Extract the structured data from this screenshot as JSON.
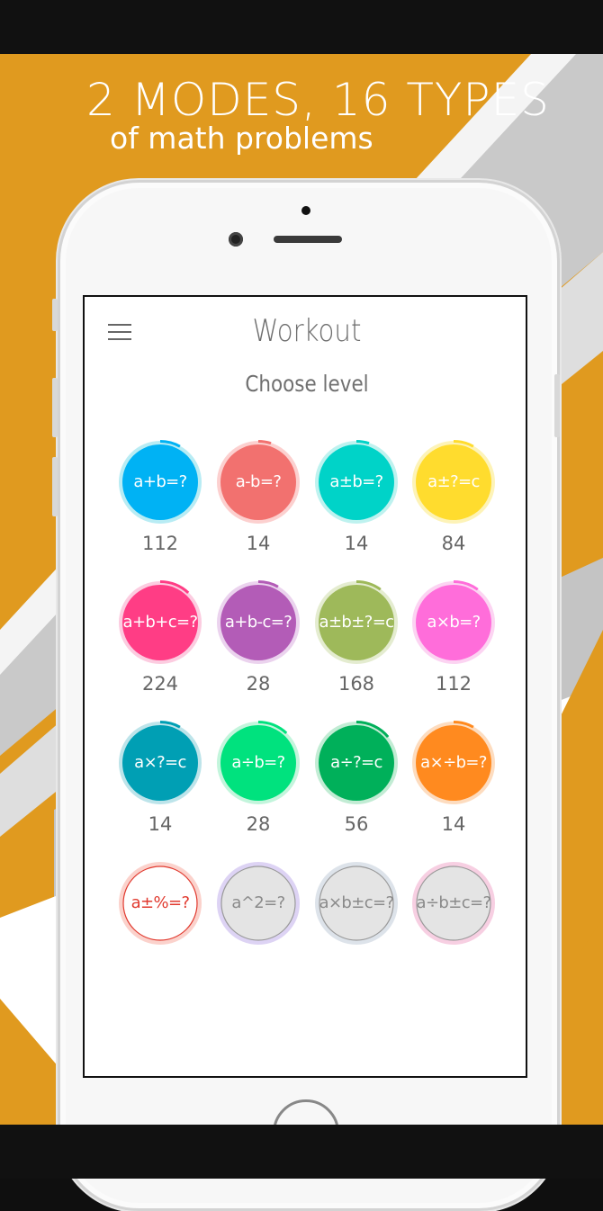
{
  "banner": {
    "line1": "2 MODES, 16 TYPES",
    "line2": "of math problems"
  },
  "colors": {
    "background_orange": "#e09a1f",
    "stripe_grey": "#c7c7c7",
    "stripe_white": "#ffffff"
  },
  "screen": {
    "title": "Workout",
    "subtitle": "Choose level",
    "menu_icon": "hamburger-menu-icon"
  },
  "levels": [
    {
      "label": "a+b=?",
      "count": "112",
      "color": "#00b2f4",
      "ring": "#b8ecf4",
      "text_color": "#ffffff",
      "progress": 0.08
    },
    {
      "label": "a-b=?",
      "count": "14",
      "color": "#f2716f",
      "ring": "#fcd0cf",
      "text_color": "#ffffff",
      "progress": 0.05
    },
    {
      "label": "a±b=?",
      "count": "14",
      "color": "#00d3c8",
      "ring": "#bef2ef",
      "text_color": "#ffffff",
      "progress": 0.05
    },
    {
      "label": "a±?=c",
      "count": "84",
      "color": "#ffdc2e",
      "ring": "#fdf3b8",
      "text_color": "#ffffff",
      "progress": 0.08
    },
    {
      "label": "a+b+c=?",
      "count": "224",
      "color": "#ff3d85",
      "ring": "#fccce0",
      "text_color": "#ffffff",
      "progress": 0.12
    },
    {
      "label": "a+b-c=?",
      "count": "28",
      "color": "#b35cb7",
      "ring": "#ebd3ee",
      "text_color": "#ffffff",
      "progress": 0.08
    },
    {
      "label": "a±b±?=c",
      "count": "168",
      "color": "#9eb95a",
      "ring": "#e4ecd0",
      "text_color": "#ffffff",
      "progress": 0.1
    },
    {
      "label": "a×b=?",
      "count": "112",
      "color": "#ff6dda",
      "ring": "#fcd4f2",
      "text_color": "#ffffff",
      "progress": 0.1
    },
    {
      "label": "a×?=c",
      "count": "14",
      "color": "#009fb4",
      "ring": "#bde4ea",
      "text_color": "#ffffff",
      "progress": 0.08
    },
    {
      "label": "a÷b=?",
      "count": "28",
      "color": "#00e27e",
      "ring": "#c3f5dc",
      "text_color": "#ffffff",
      "progress": 0.12
    },
    {
      "label": "a÷?=c",
      "count": "56",
      "color": "#00b05a",
      "ring": "#c2ecd4",
      "text_color": "#ffffff",
      "progress": 0.14
    },
    {
      "label": "a×÷b=?",
      "count": "14",
      "color": "#ff8a1f",
      "ring": "#fddcbf",
      "text_color": "#ffffff",
      "progress": 0.08
    },
    {
      "label": "a±%=?",
      "count": "",
      "color": "#ffffff",
      "ring": "#fbd2cc",
      "text_color": "#e13a2f",
      "inner_border": "#e13a2f",
      "progress": 0
    },
    {
      "label": "a^2=?",
      "count": "",
      "color": "#e4e4e4",
      "ring": "#ddd3f4",
      "text_color": "#8a8a8a",
      "inner_border": "#9a9a9a",
      "progress": 0
    },
    {
      "label": "a×b±c=?",
      "count": "",
      "color": "#e4e4e4",
      "ring": "#dde3ea",
      "text_color": "#8a8a8a",
      "inner_border": "#9a9a9a",
      "progress": 0
    },
    {
      "label": "a÷b±c=?",
      "count": "",
      "color": "#e4e4e4",
      "ring": "#f7cfe2",
      "text_color": "#8a8a8a",
      "inner_border": "#9a9a9a",
      "progress": 0
    }
  ]
}
